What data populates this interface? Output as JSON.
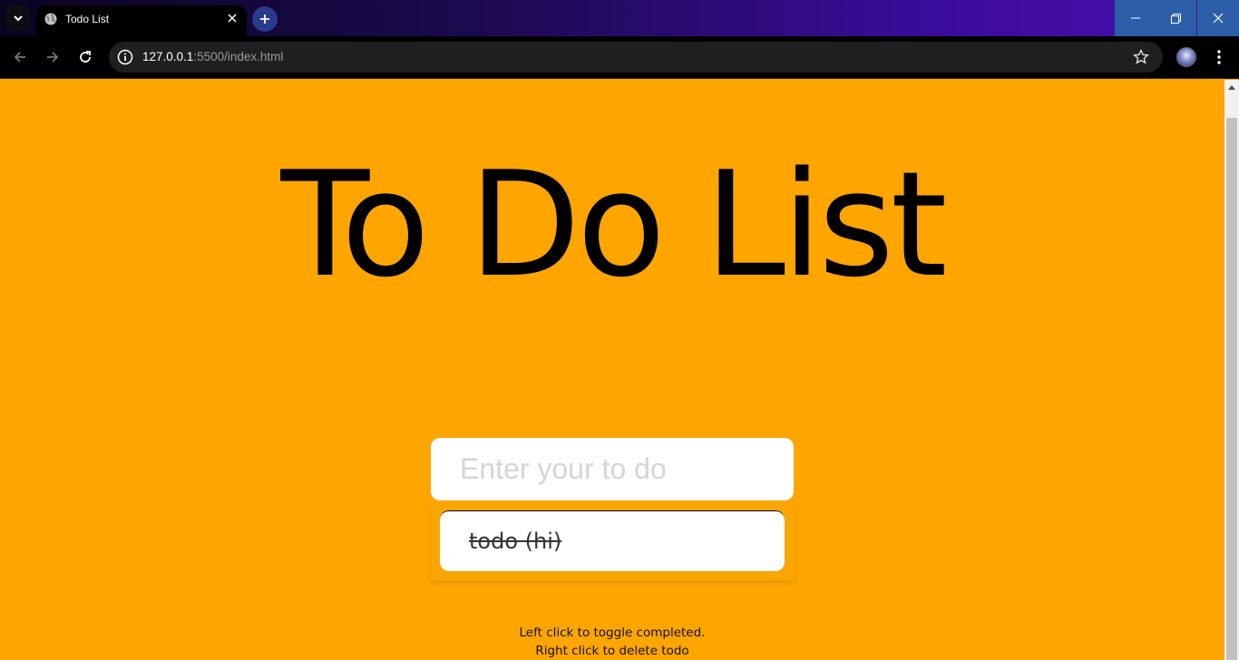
{
  "browser": {
    "tab": {
      "title": "Todo List"
    },
    "url": {
      "host": "127.0.0.1",
      "path": ":5500/index.html"
    },
    "icons": {
      "tab_search": "chevron-down-icon",
      "favicon": "globe-icon",
      "tab_close": "close-icon",
      "new_tab": "plus-icon",
      "back": "arrow-left-icon",
      "forward": "arrow-right-icon",
      "reload": "reload-icon",
      "site_info": "info-icon",
      "bookmark": "star-icon",
      "menu": "kebab-menu-icon"
    },
    "colors": {
      "tabbar_accent": "#4a10b0",
      "window_controls": "#2d5fa8"
    }
  },
  "page": {
    "heading": "To Do List",
    "input": {
      "placeholder": "Enter your to do",
      "value": ""
    },
    "todos": [
      {
        "text": "todo (hi)",
        "completed": true
      }
    ],
    "help": {
      "line1": "Left click to toggle completed.",
      "line2": "Right click to delete todo"
    },
    "colors": {
      "background": "#ffa500",
      "card": "#ffffff"
    }
  }
}
